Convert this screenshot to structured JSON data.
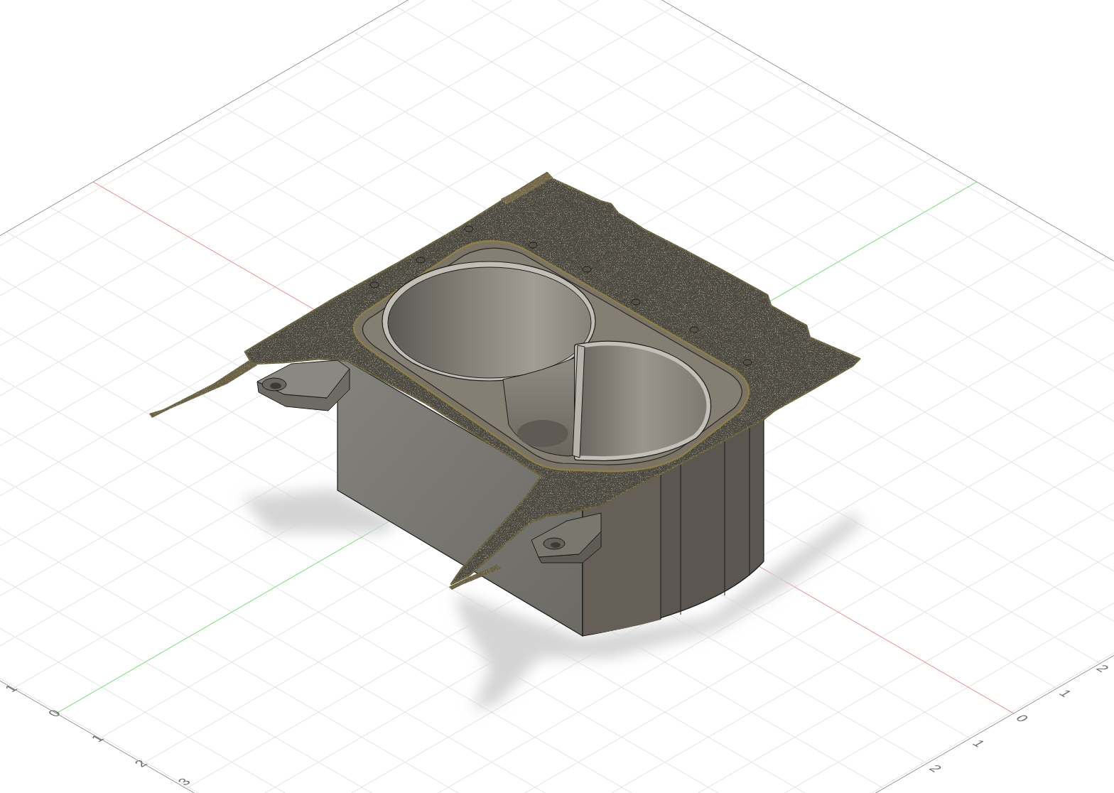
{
  "viewport": {
    "grid": {
      "bottom_left_labels": [
        "1",
        "0",
        "1",
        "2",
        "3"
      ],
      "bottom_right_labels": [
        "2",
        "1",
        "0",
        "1",
        "2"
      ]
    }
  }
}
